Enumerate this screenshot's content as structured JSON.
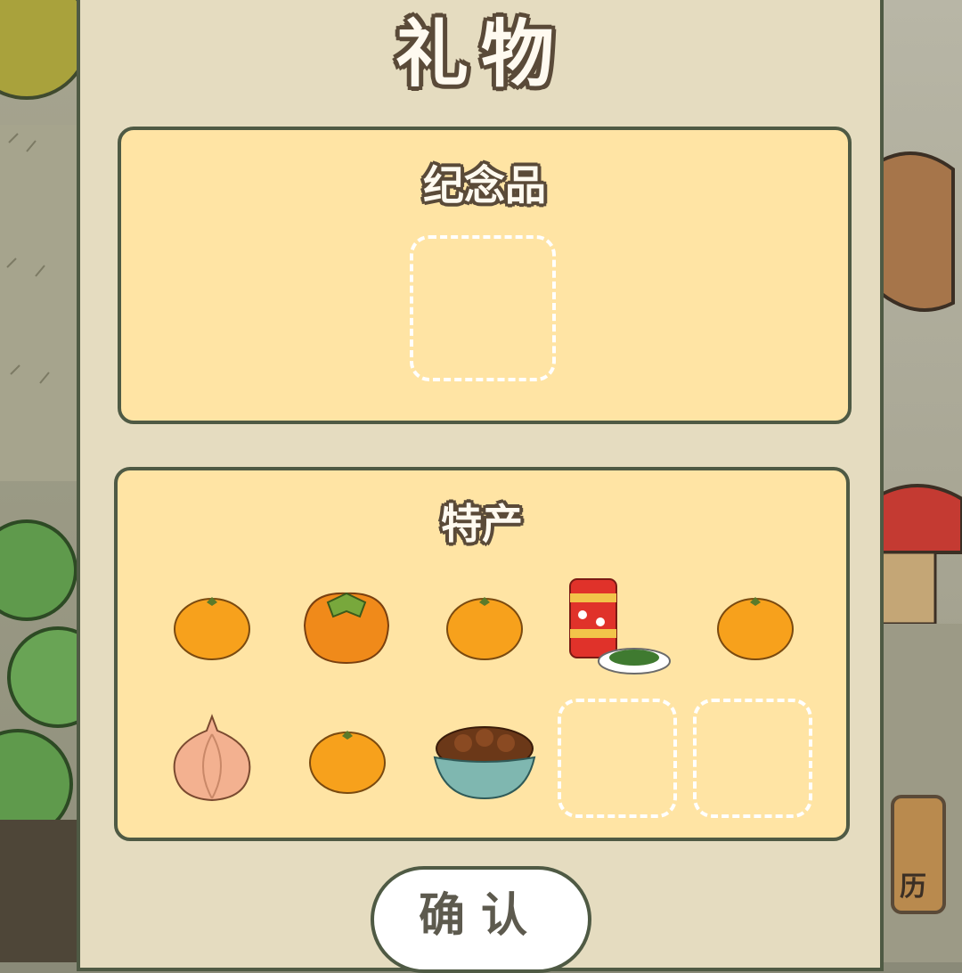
{
  "title": "礼物",
  "souvenir": {
    "heading": "纪念品"
  },
  "specialty": {
    "heading": "特产",
    "items": [
      "orange-icon",
      "persimmon-icon",
      "orange-icon",
      "canned-tea-and-greens-icon",
      "orange-icon",
      "onion-icon",
      "orange-icon",
      "chestnut-bowl-icon"
    ],
    "empty_slots": 2
  },
  "confirm_label": "确认",
  "side_button_label": "历",
  "colors": {
    "panel": "#e5dcc0",
    "box": "#ffe4a4",
    "border": "#4f5a44",
    "orange": "#f7a11c"
  }
}
